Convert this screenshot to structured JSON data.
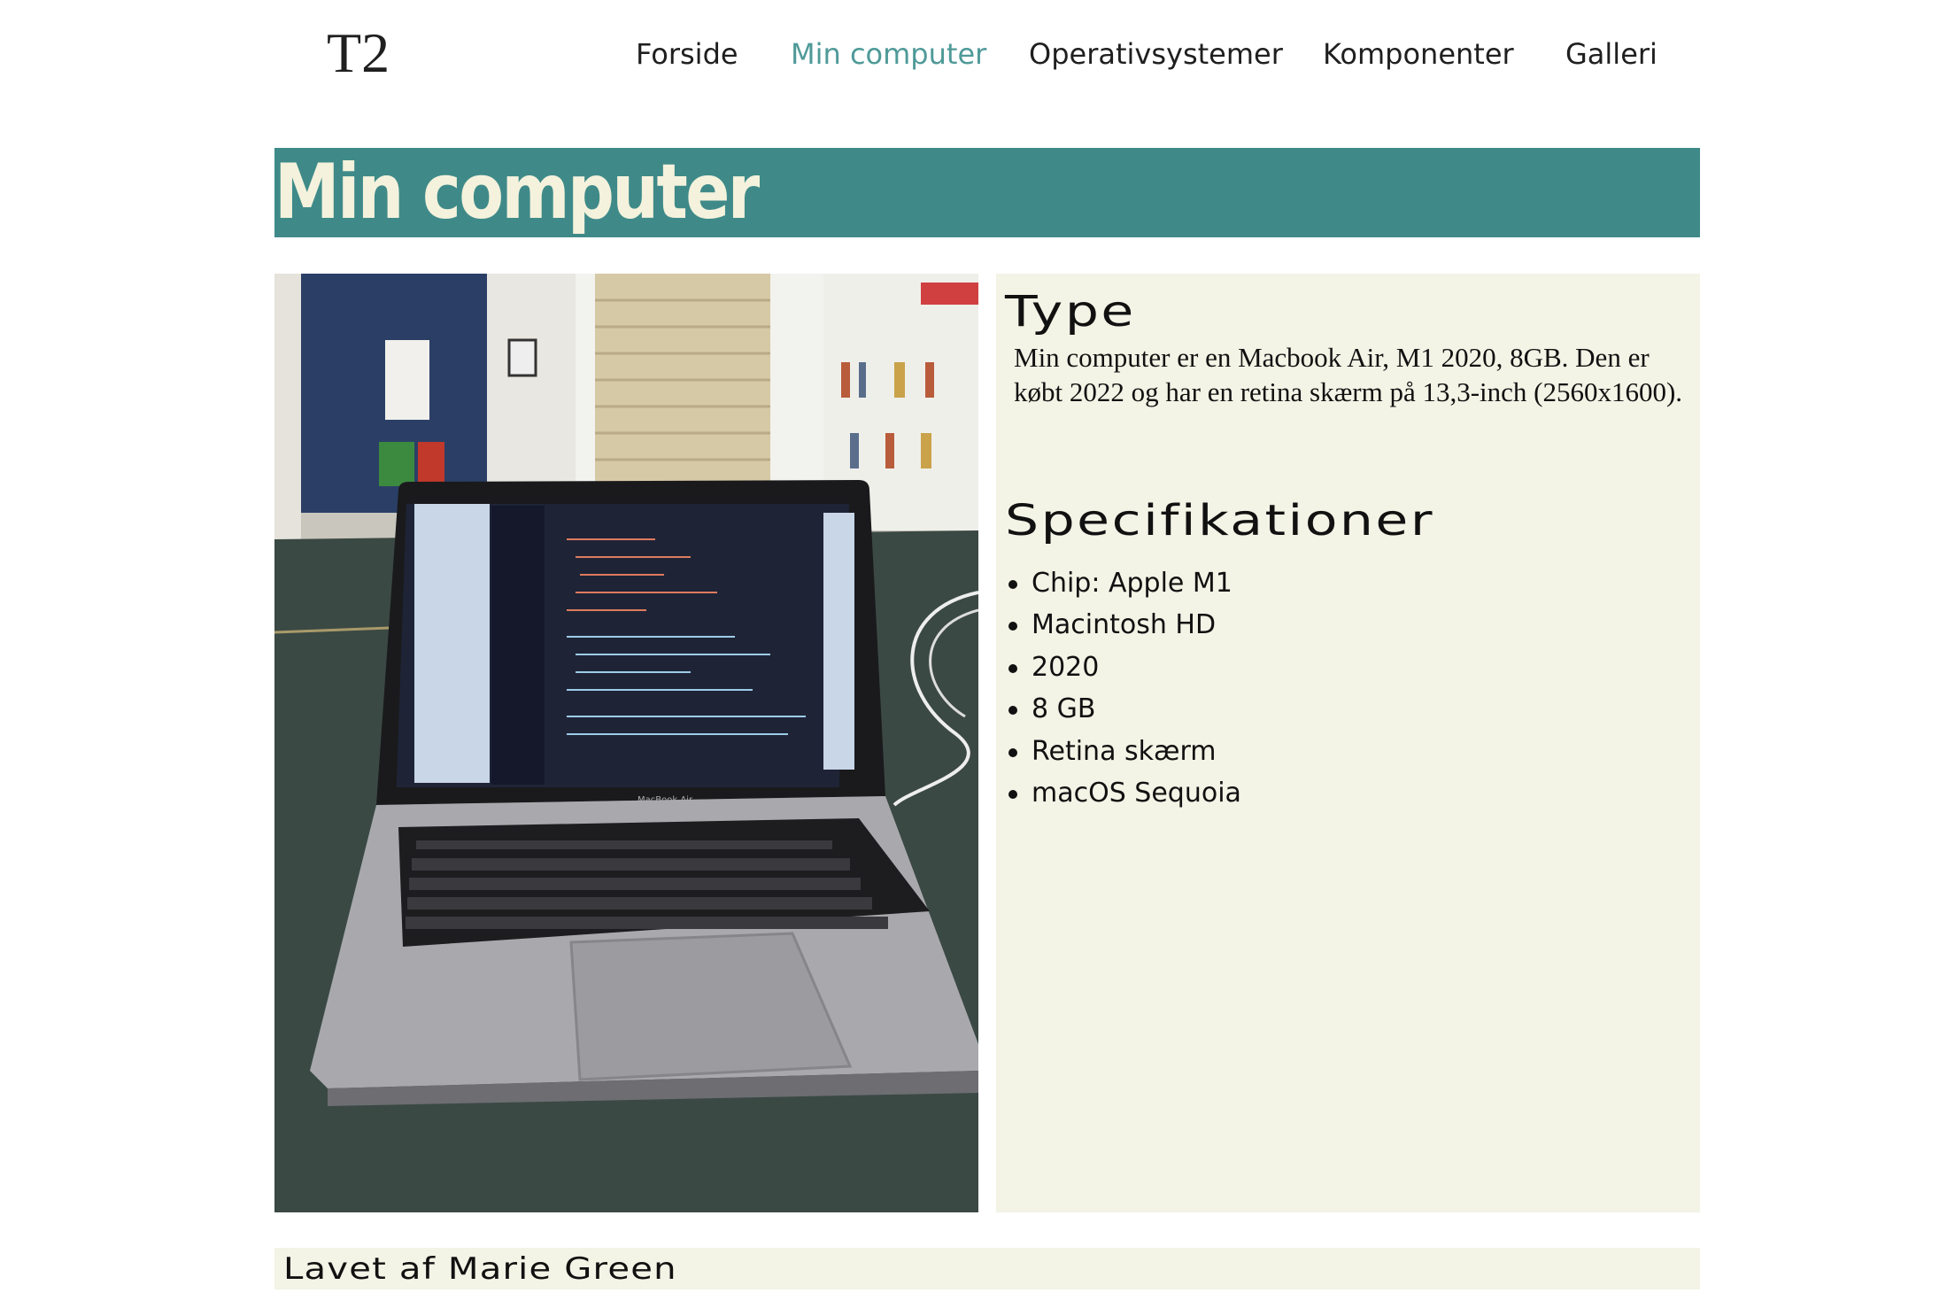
{
  "header": {
    "logo": "T2",
    "nav": [
      {
        "label": "Forside",
        "active": false
      },
      {
        "label": "Min computer",
        "active": true
      },
      {
        "label": "Operativsystemer",
        "active": false
      },
      {
        "label": "Komponenter",
        "active": false
      },
      {
        "label": "Galleri",
        "active": false
      }
    ]
  },
  "main": {
    "title": "Min computer",
    "photo": {
      "laptop_label": "MacBook Air"
    },
    "type_section": {
      "heading": "Type",
      "text": "Min computer er en Macbook Air, M1 2020, 8GB. Den er købt 2022 og har en retina skærm på 13,3-inch (2560x1600)."
    },
    "spec_section": {
      "heading": "Specifikationer",
      "items": [
        "Chip: Apple M1",
        "Macintosh HD",
        "2020",
        "8 GB",
        "Retina skærm",
        "macOS Sequoia"
      ]
    }
  },
  "footer": {
    "text": "Lavet af Marie Green"
  },
  "colors": {
    "accent": "#3f8a89",
    "nav_active": "#4f9a99",
    "banner_text": "#f4f2dc",
    "panel_bg": "#f3f3e6"
  }
}
